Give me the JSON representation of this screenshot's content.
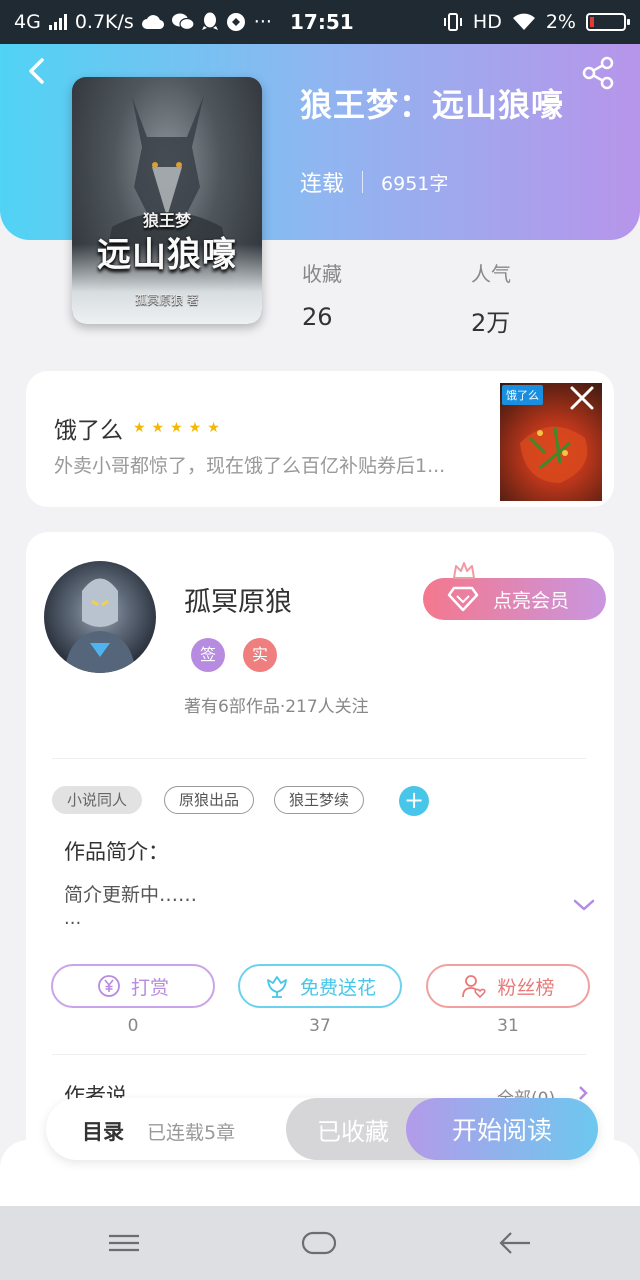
{
  "status_bar": {
    "network": "4G",
    "speed": "0.7K/s",
    "time": "17:51",
    "hd": "HD",
    "battery": "2%",
    "more": "···"
  },
  "header": {
    "book_title": "狼王梦：远山狼嚎",
    "status": "连载",
    "word_count": "6951字",
    "cover": {
      "small_title": "狼王梦",
      "big_title": "远山狼嚎",
      "author_line": "孤冥原狼 著"
    }
  },
  "stats": {
    "favorites_label": "收藏",
    "favorites_value": "26",
    "popularity_label": "人气",
    "popularity_value": "2万"
  },
  "ad": {
    "title": "饿了么",
    "stars": "★★★★★",
    "description": "外卖小哥都惊了，现在饿了么百亿补贴券后1...",
    "logo_text": "饿了么"
  },
  "author": {
    "name": "孤冥原狼",
    "badge_sign": "签",
    "badge_real": "实",
    "info": "著有6部作品·217人关注",
    "vip_button": "点亮会员"
  },
  "tags": [
    "小说同人",
    "原狼出品",
    "狼王梦续"
  ],
  "tag_add": "+",
  "intro": {
    "label": "作品简介：",
    "text": "简介更新中……",
    "more": "..."
  },
  "actions": [
    {
      "label": "打赏",
      "count": "0"
    },
    {
      "label": "免费送花",
      "count": "37"
    },
    {
      "label": "粉丝榜",
      "count": "31"
    }
  ],
  "author_say": {
    "label": "作者说",
    "all": "全部(0)"
  },
  "read_bar": {
    "toc_label": "目录",
    "toc_status": "已连载5章",
    "favorite_button": "已收藏",
    "start_button": "开始阅读"
  },
  "colors": {
    "gradient_start": "#50d3f4",
    "gradient_end": "#b795ea",
    "reward": "#b78be0",
    "flower": "#47c6ea",
    "fans": "#e97a7a",
    "star": "#f5b800"
  }
}
